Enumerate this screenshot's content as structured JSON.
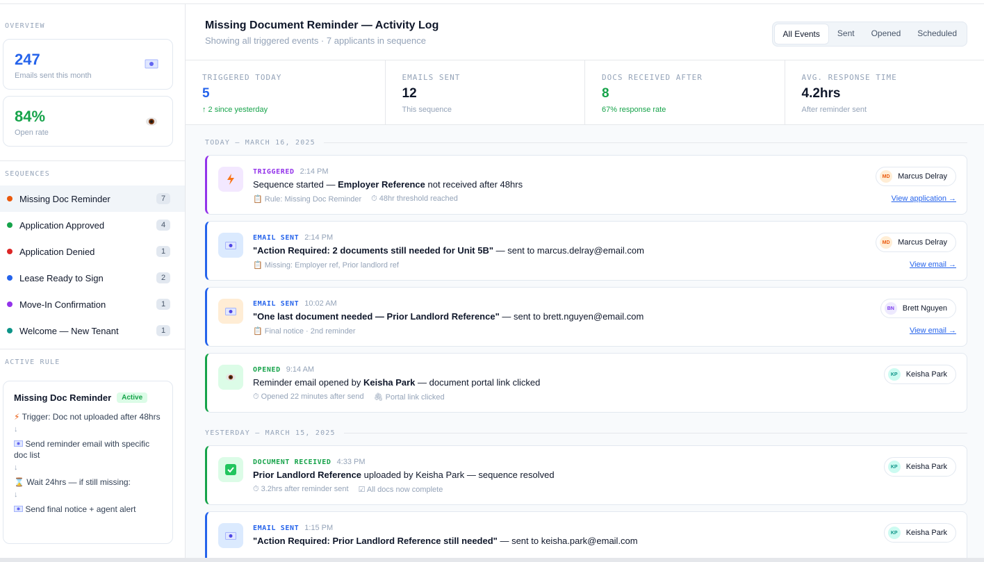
{
  "sidebar": {
    "overview_label": "OVERVIEW",
    "stats": [
      {
        "value": "247",
        "label": "Emails sent this month",
        "icon": "envelope-icon",
        "color": "#2563eb"
      },
      {
        "value": "84%",
        "label": "Open rate",
        "icon": "eye-icon",
        "color": "#16a34a"
      }
    ],
    "sequences_label": "SEQUENCES",
    "sequences": [
      {
        "name": "Missing Doc Reminder",
        "count": "7",
        "color": "#ea580c",
        "active": true
      },
      {
        "name": "Application Approved",
        "count": "4",
        "color": "#16a34a"
      },
      {
        "name": "Application Denied",
        "count": "1",
        "color": "#dc2626"
      },
      {
        "name": "Lease Ready to Sign",
        "count": "2",
        "color": "#2563eb"
      },
      {
        "name": "Move-In Confirmation",
        "count": "1",
        "color": "#9333ea"
      },
      {
        "name": "Welcome — New Tenant",
        "count": "1",
        "color": "#0d9488"
      }
    ],
    "active_rule_label": "ACTIVE RULE",
    "rule": {
      "title": "Missing Doc Reminder",
      "badge": "Active",
      "steps": [
        {
          "icon": "lightning-icon",
          "text": "Trigger: Doc not uploaded after 48hrs"
        },
        {
          "icon": "envelope-icon",
          "text": "Send reminder email with specific doc list"
        },
        {
          "icon": "hourglass-icon",
          "text": "Wait 24hrs — if still missing:"
        },
        {
          "icon": "envelope-icon",
          "text": "Send final notice + agent alert"
        }
      ],
      "arrow": "↓"
    }
  },
  "header": {
    "title": "Missing Document Reminder — Activity Log",
    "subtitle": "Showing all triggered events · 7 applicants in sequence",
    "tabs": [
      "All Events",
      "Sent",
      "Opened",
      "Scheduled"
    ]
  },
  "stats": [
    {
      "label": "TRIGGERED TODAY",
      "value": "5",
      "sub": "↑ 2 since yesterday",
      "value_color": "#2563eb",
      "sub_color": "#16a34a"
    },
    {
      "label": "EMAILS SENT",
      "value": "12",
      "sub": "This sequence",
      "value_color": "#0f172a",
      "sub_color": "#94a3b8"
    },
    {
      "label": "DOCS RECEIVED AFTER",
      "value": "8",
      "sub": "67% response rate",
      "value_color": "#16a34a",
      "sub_color": "#16a34a"
    },
    {
      "label": "AVG. RESPONSE TIME",
      "value": "4.2hrs",
      "sub": "After reminder sent",
      "value_color": "#0f172a",
      "sub_color": "#94a3b8"
    }
  ],
  "days": [
    {
      "label": "TODAY — MARCH 16, 2025",
      "events": [
        {
          "type": "TRIGGERED",
          "type_color": "#9333ea",
          "border": "#9333ea",
          "icon_bg": "#f3e8ff",
          "icon": "lightning-icon",
          "time": "2:14 PM",
          "parts": [
            {
              "t": "Sequence started — "
            },
            {
              "t": "Employer Reference",
              "b": true
            },
            {
              "t": " not received after 48hrs"
            }
          ],
          "meta": [
            "📋 Rule: Missing Doc Reminder",
            "⏱ 48hr threshold reached"
          ],
          "person": "Marcus Delray",
          "initials": "MD",
          "av_bg": "#ffedd5",
          "av_fg": "#ea580c",
          "link": "View application →"
        },
        {
          "type": "EMAIL SENT",
          "type_color": "#2563eb",
          "border": "#2563eb",
          "icon_bg": "#dbeafe",
          "icon": "envelope-icon",
          "time": "2:14 PM",
          "parts": [
            {
              "t": "\"Action Required: 2 documents still needed for Unit 5B\"",
              "b": true
            },
            {
              "t": " — sent to marcus.delray@email.com"
            }
          ],
          "meta": [
            "📋 Missing: Employer ref, Prior landlord ref"
          ],
          "person": "Marcus Delray",
          "initials": "MD",
          "av_bg": "#ffedd5",
          "av_fg": "#ea580c",
          "link": "View email →"
        },
        {
          "type": "EMAIL SENT",
          "type_color": "#2563eb",
          "border": "#2563eb",
          "icon_bg": "#ffedd5",
          "icon": "envelope-icon",
          "time": "10:02 AM",
          "parts": [
            {
              "t": "\"One last document needed — Prior Landlord Reference\"",
              "b": true
            },
            {
              "t": " — sent to brett.nguyen@email.com"
            }
          ],
          "meta": [
            "📋 Final notice · 2nd reminder"
          ],
          "person": "Brett Nguyen",
          "initials": "BN",
          "av_bg": "#ede9fe",
          "av_fg": "#7c3aed",
          "link": "View email →"
        },
        {
          "type": "OPENED",
          "type_color": "#16a34a",
          "border": "#16a34a",
          "icon_bg": "#dcfce7",
          "icon": "eye-icon",
          "time": "9:14 AM",
          "parts": [
            {
              "t": "Reminder email opened by "
            },
            {
              "t": "Keisha Park",
              "b": true
            },
            {
              "t": " — document portal link clicked"
            }
          ],
          "meta": [
            "⏱ Opened 22 minutes after send",
            "🖇 Portal link clicked"
          ],
          "person": "Keisha Park",
          "initials": "KP",
          "av_bg": "#ccfbf1",
          "av_fg": "#0d9488",
          "link": ""
        }
      ]
    },
    {
      "label": "YESTERDAY — MARCH 15, 2025",
      "events": [
        {
          "type": "DOCUMENT RECEIVED",
          "type_color": "#16a34a",
          "border": "#16a34a",
          "icon_bg": "#dcfce7",
          "icon": "check-icon",
          "time": "4:33 PM",
          "parts": [
            {
              "t": "Prior Landlord Reference",
              "b": true
            },
            {
              "t": " uploaded by Keisha Park — sequence resolved"
            }
          ],
          "meta": [
            "⏱ 3.2hrs after reminder sent",
            "☑ All docs now complete"
          ],
          "person": "Keisha Park",
          "initials": "KP",
          "av_bg": "#ccfbf1",
          "av_fg": "#0d9488",
          "link": ""
        },
        {
          "type": "EMAIL SENT",
          "type_color": "#2563eb",
          "border": "#2563eb",
          "icon_bg": "#dbeafe",
          "icon": "envelope-icon",
          "time": "1:15 PM",
          "parts": [
            {
              "t": "\"Action Required: Prior Landlord Reference still needed\"",
              "b": true
            },
            {
              "t": " — sent to keisha.park@email.com"
            }
          ],
          "meta": [],
          "person": "Keisha Park",
          "initials": "KP",
          "av_bg": "#ccfbf1",
          "av_fg": "#0d9488",
          "link": ""
        }
      ]
    }
  ]
}
